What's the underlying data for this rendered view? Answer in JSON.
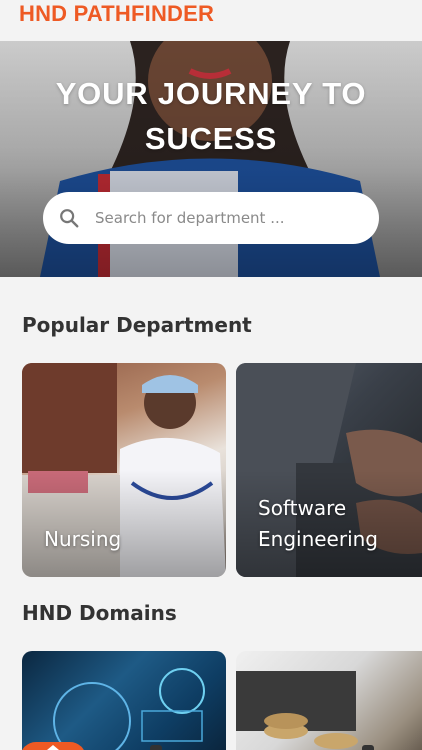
{
  "header": {
    "brand": "HND PATHFINDER"
  },
  "hero": {
    "title_line1": "YOUR JOURNEY TO",
    "title_line2": "SUCESS",
    "search_placeholder": "Search for department ..."
  },
  "popular": {
    "heading": "Popular Department",
    "items": [
      {
        "label": "Nursing"
      },
      {
        "label_line1": "Software",
        "label_line2": "Engineering"
      }
    ]
  },
  "domains": {
    "heading": "HND Domains"
  },
  "colors": {
    "brand": "#ee5a24",
    "background": "#f3f3f3",
    "heading": "#333333"
  },
  "icons": {
    "search": "search-icon",
    "home": "home-icon"
  }
}
